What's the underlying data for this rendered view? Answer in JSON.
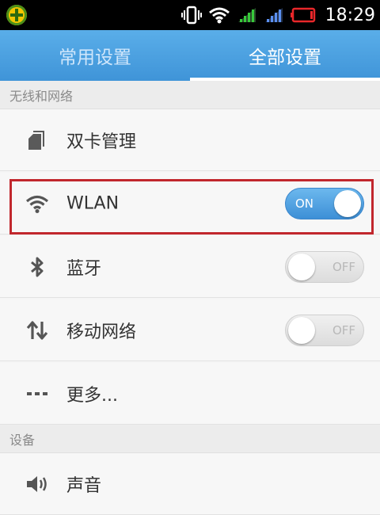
{
  "status_bar": {
    "time": "18:29",
    "icons": [
      "app-badge-icon",
      "vibrate-icon",
      "wifi-icon",
      "signal-icon",
      "signal-icon",
      "battery-low-icon"
    ],
    "battery_color": "#e8272a"
  },
  "tabs": [
    {
      "label": "常用设置",
      "active": false
    },
    {
      "label": "全部设置",
      "active": true
    }
  ],
  "sections": [
    {
      "title": "无线和网络"
    },
    {
      "title": "设备"
    }
  ],
  "rows": {
    "dual_sim": {
      "label": "双卡管理",
      "icon": "sim-card-icon"
    },
    "wlan": {
      "label": "WLAN",
      "icon": "wifi-icon",
      "toggle": "ON"
    },
    "bluetooth": {
      "label": "蓝牙",
      "icon": "bluetooth-icon",
      "toggle": "OFF"
    },
    "mobile_network": {
      "label": "移动网络",
      "icon": "data-transfer-icon",
      "toggle": "OFF"
    },
    "more": {
      "label": "更多...",
      "icon": "more-icon"
    },
    "sound": {
      "label": "声音",
      "icon": "speaker-icon"
    }
  },
  "colors": {
    "accent": "#3f94d8",
    "highlight_border": "#c1272d"
  }
}
